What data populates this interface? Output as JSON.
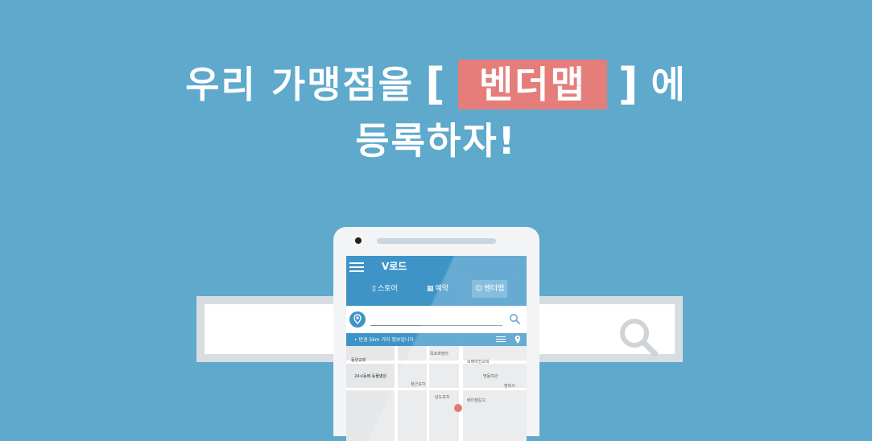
{
  "headline": {
    "line1_prefix": "우리 가맹점을",
    "bracket_open": "[",
    "highlight": "벤더맵",
    "bracket_close": "]",
    "line1_suffix": "에",
    "line2": "등록하자!"
  },
  "app": {
    "title": "V로드",
    "tabs": [
      {
        "icon": "bag-icon",
        "label": "스토어"
      },
      {
        "icon": "calendar-icon",
        "label": "예약"
      },
      {
        "icon": "person-icon",
        "label": "벤더맵"
      }
    ],
    "info_text": "• 반경 5km 거리 정보입니다",
    "map_labels": [
      "목포파렌타",
      "동양교회",
      "보배비전교회",
      "24시동배 동물병원",
      "명동여관",
      "청군포차",
      "남도포차",
      "영락사",
      "배미쉘갈고"
    ]
  },
  "colors": {
    "background": "#5ea9cc",
    "highlight": "#e57d7a",
    "app_header": "#3e94c6"
  }
}
